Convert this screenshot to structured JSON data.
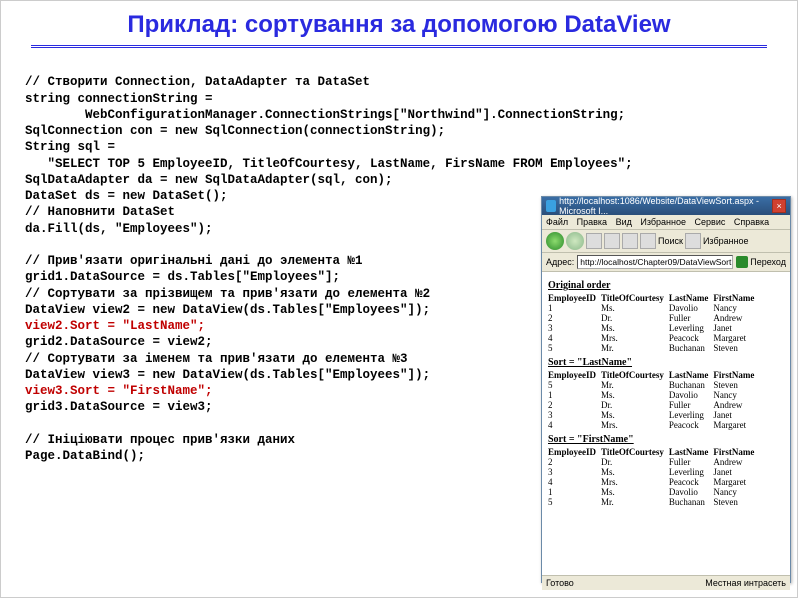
{
  "title": "Приклад: сортування за допомогою DataView",
  "code": {
    "c1": "// Створити Connection, DataAdapter та DataSet",
    "c2": "string connectionString =",
    "c3": "        WebConfigurationManager.ConnectionStrings[\"Northwind\"].ConnectionString;",
    "c4": "SqlConnection con = new SqlConnection(connectionString);",
    "c5": "String sql =",
    "c6": "   \"SELECT TOP 5 EmployeeID, TitleOfCourtesy, LastName, FirsName FROM Employees\";",
    "c7": "SqlDataAdapter da = new SqlDataAdapter(sql, con);",
    "c8": "DataSet ds = new DataSet();",
    "c9": "// Наповнити DataSet",
    "c10": "da.Fill(ds, \"Employees\");",
    "c11": "",
    "c12": "// Прив'язати оригінальні дані до элемента №1",
    "c13": "grid1.DataSource = ds.Tables[\"Employees\"];",
    "c14": "// Сортувати за прізвищем та прив'язати до елемента №2",
    "c15": "DataView view2 = new DataView(ds.Tables[\"Employees\"]);",
    "c16": "view2.Sort = \"LastName\";",
    "c17": "grid2.DataSource = view2;",
    "c18": "// Сортувати за іменем та прив'язати до елемента №3",
    "c19": "DataView view3 = new DataView(ds.Tables[\"Employees\"]);",
    "c20": "view3.Sort = \"FirstName\";",
    "c21": "grid3.DataSource = view3;",
    "c22": "",
    "c23": "// Ініціювати процес прив'язки даних",
    "c24": "Page.DataBind();"
  },
  "browser": {
    "title": "http://localhost:1086/Website/DataViewSort.aspx - Microsoft I...",
    "menu": [
      "Файл",
      "Правка",
      "Вид",
      "Избранное",
      "Сервис",
      "Справка"
    ],
    "tools": {
      "search": "Поиск",
      "fav": "Избранное"
    },
    "addr_label": "Адрес:",
    "addr": "http://localhost/Chapter09/DataViewSort.aspx",
    "go": "Переход",
    "heading1": "Original order",
    "heading2": "Sort = \"LastName\"",
    "heading3": "Sort = \"FirstName\"",
    "cols": [
      "EmployeeID",
      "TitleOfCourtesy",
      "LastName",
      "FirstName"
    ],
    "table1": [
      [
        "1",
        "Ms.",
        "Davolio",
        "Nancy"
      ],
      [
        "2",
        "Dr.",
        "Fuller",
        "Andrew"
      ],
      [
        "3",
        "Ms.",
        "Leverling",
        "Janet"
      ],
      [
        "4",
        "Mrs.",
        "Peacock",
        "Margaret"
      ],
      [
        "5",
        "Mr.",
        "Buchanan",
        "Steven"
      ]
    ],
    "table2": [
      [
        "5",
        "Mr.",
        "Buchanan",
        "Steven"
      ],
      [
        "1",
        "Ms.",
        "Davolio",
        "Nancy"
      ],
      [
        "2",
        "Dr.",
        "Fuller",
        "Andrew"
      ],
      [
        "3",
        "Ms.",
        "Leverling",
        "Janet"
      ],
      [
        "4",
        "Mrs.",
        "Peacock",
        "Margaret"
      ]
    ],
    "table3": [
      [
        "2",
        "Dr.",
        "Fuller",
        "Andrew"
      ],
      [
        "3",
        "Ms.",
        "Leverling",
        "Janet"
      ],
      [
        "4",
        "Mrs.",
        "Peacock",
        "Margaret"
      ],
      [
        "1",
        "Ms.",
        "Davolio",
        "Nancy"
      ],
      [
        "5",
        "Mr.",
        "Buchanan",
        "Steven"
      ]
    ],
    "status_ready": "Готово",
    "status_zone": "Местная интрасеть"
  }
}
